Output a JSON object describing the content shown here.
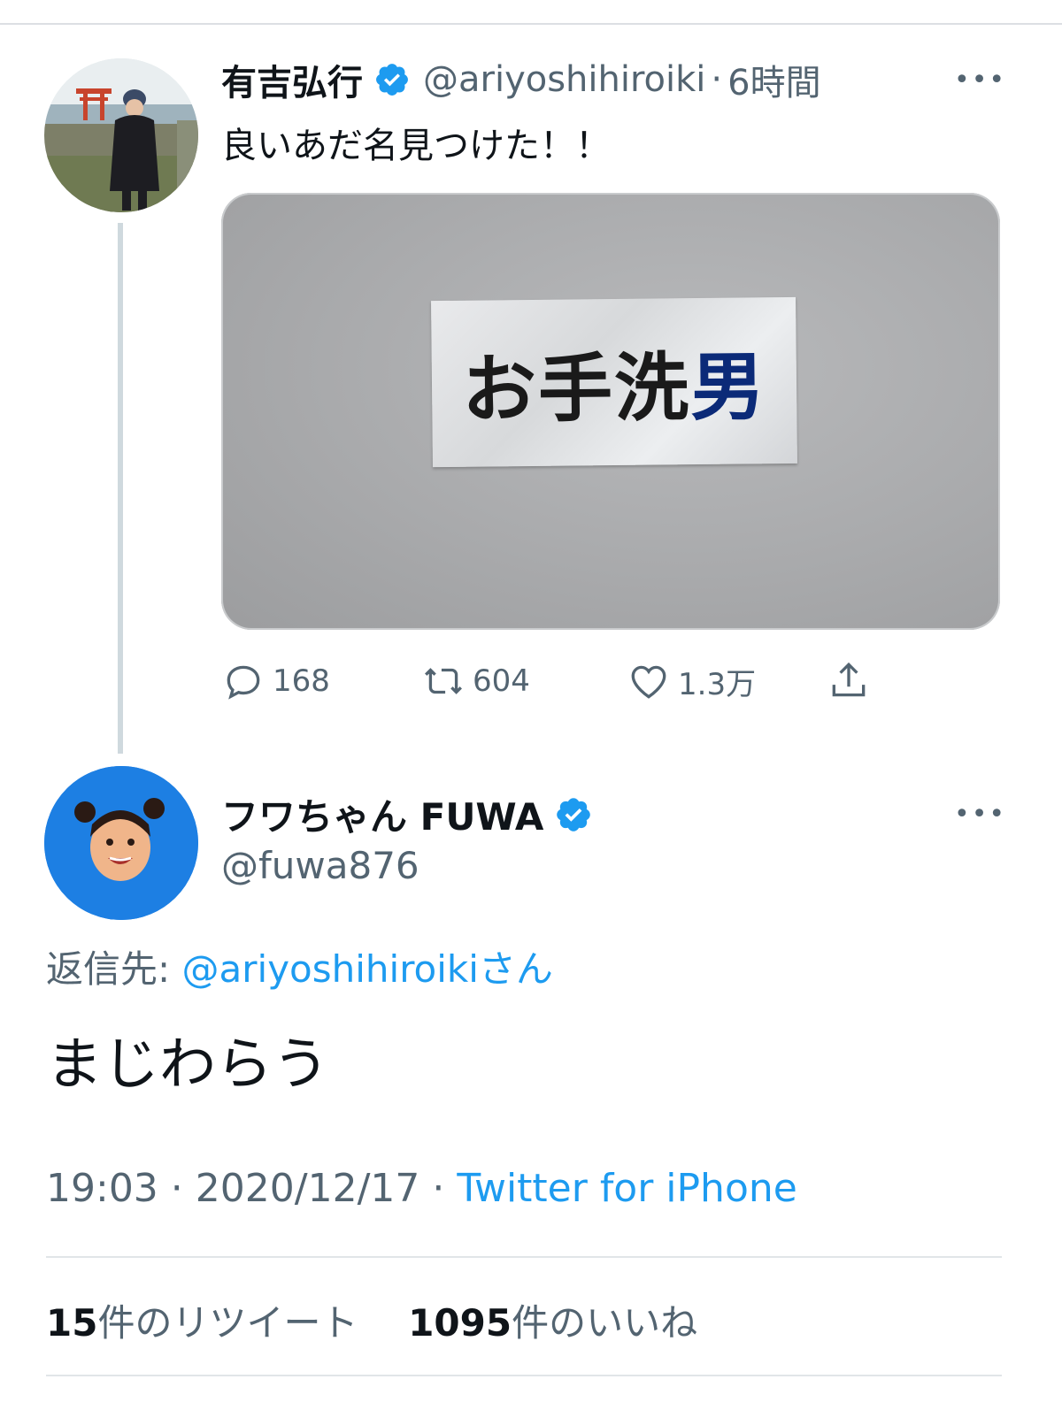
{
  "parent_tweet": {
    "display_name": "有吉弘行",
    "handle": "@ariyoshihiroiki",
    "separator": "·",
    "time": "6時間",
    "more_label": "•••",
    "text": "良いあだ名見つけた！！",
    "media_sign_text": "お手洗",
    "media_sign_accent": "男",
    "actions": {
      "replies": "168",
      "retweets": "604",
      "likes": "1.3万"
    }
  },
  "reply_tweet": {
    "display_name": "フワちゃん FUWA",
    "handle": "@fuwa876",
    "more_label": "•••",
    "replying_prefix": "返信先: ",
    "replying_to": "@ariyoshihiroikiさん",
    "text": "まじわらう",
    "time": "19:03",
    "dot": " · ",
    "date": "2020/12/17",
    "source": "Twitter for iPhone",
    "retweet_count": "15",
    "retweet_label": "件のリツイート",
    "like_count": "1095",
    "like_label": "件のいいね"
  },
  "colors": {
    "accent": "#1d9bf0",
    "verified": "#1d9bf0",
    "muted_text": "#536471",
    "primary_text": "#0f1419"
  },
  "icons": [
    "verified-badge-icon",
    "more-icon",
    "reply-icon",
    "retweet-icon",
    "like-icon",
    "share-icon"
  ]
}
